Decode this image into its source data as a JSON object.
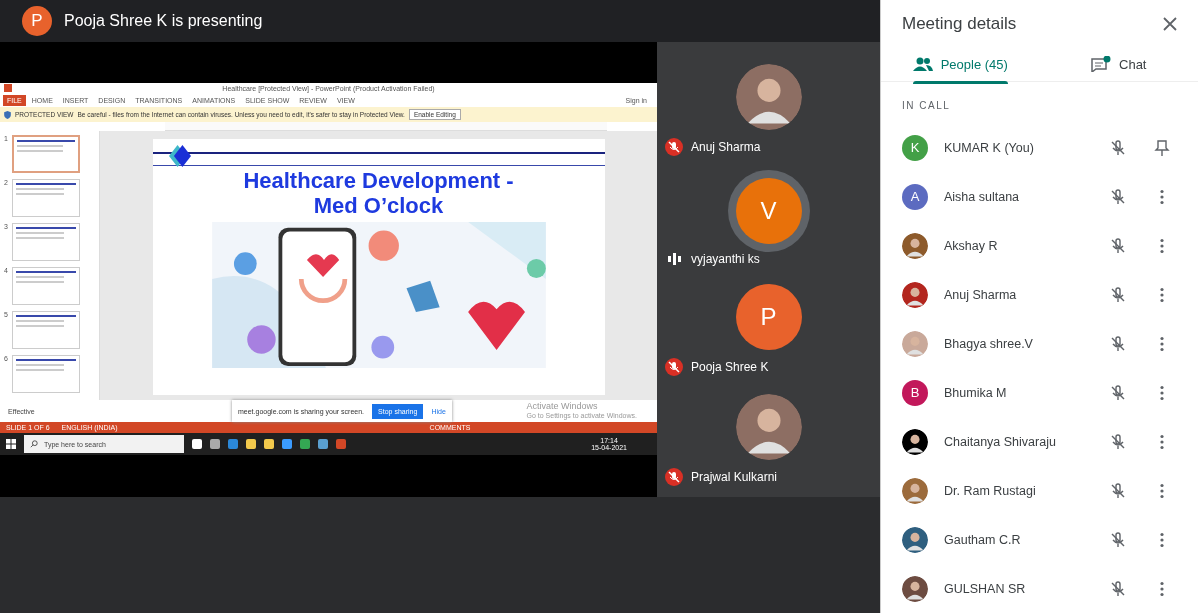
{
  "presenter_banner": {
    "letter": "P",
    "color": "#e8622c",
    "text": "Pooja Shree K is presenting"
  },
  "shared_screen": {
    "app_title": "Healthcare [Protected View] - PowerPoint (Product Activation Failed)",
    "ribbon_tabs": [
      {
        "label": "FILE",
        "selected": true
      },
      {
        "label": "HOME",
        "selected": false
      },
      {
        "label": "INSERT",
        "selected": false
      },
      {
        "label": "DESIGN",
        "selected": false
      },
      {
        "label": "TRANSITIONS",
        "selected": false
      },
      {
        "label": "ANIMATIONS",
        "selected": false
      },
      {
        "label": "SLIDE SHOW",
        "selected": false
      },
      {
        "label": "REVIEW",
        "selected": false
      },
      {
        "label": "VIEW",
        "selected": false
      }
    ],
    "sign_in": "Sign in",
    "protected_bar": {
      "label": "PROTECTED VIEW",
      "message": "Be careful - files from the Internet can contain viruses. Unless you need to edit, it's safer to stay in Protected View.",
      "button": "Enable Editing"
    },
    "thumbnails": [
      {
        "number": "1",
        "selected": true
      },
      {
        "number": "2",
        "selected": false
      },
      {
        "number": "3",
        "selected": false
      },
      {
        "number": "4",
        "selected": false
      },
      {
        "number": "5",
        "selected": false
      },
      {
        "number": "6",
        "selected": false
      }
    ],
    "slide": {
      "title": "Healthcare Development -",
      "subtitle": "Med O’clock"
    },
    "notes": "Effective",
    "activation": {
      "title": "Activate Windows",
      "text": "Go to Settings to activate Windows."
    },
    "sharing_bar": {
      "message": "meet.google.com is sharing your screen.",
      "stop": "Stop sharing",
      "hide": "Hide"
    },
    "status_bar": [
      "SLIDE 1 OF 6",
      "ENGLISH (INDIA)",
      "COMMENTS"
    ],
    "taskbar": {
      "search_placeholder": "Type here to search",
      "time": "17:14",
      "date": "15-04-2021"
    }
  },
  "tiles": [
    {
      "name": "Anuj Sharma",
      "muted": true
    },
    {
      "name": "vyjayanthi ks",
      "kind": "letter",
      "letter": "V",
      "color": "#e8710a",
      "muted": false
    },
    {
      "name": "Pooja Shree K",
      "kind": "letter",
      "letter": "P",
      "color": "#e8622c",
      "muted": true
    },
    {
      "name": "Prajwal Kulkarni",
      "muted": true
    }
  ],
  "panel": {
    "title": "Meeting details",
    "tabs": [
      {
        "label": "People (45)",
        "kind": "people",
        "selected": true
      },
      {
        "label": "Chat",
        "kind": "chat",
        "selected": false,
        "unread": true
      }
    ],
    "section": "IN CALL",
    "people": [
      {
        "name": "KUMAR K (You)",
        "kind": "letter",
        "letter": "K",
        "color": "#43a047",
        "self": true
      },
      {
        "name": "Aisha sultana",
        "kind": "letter",
        "letter": "A",
        "color": "#5c6bc0",
        "self": false
      },
      {
        "name": "Akshay R",
        "color": "#8d5a2b",
        "self": false
      },
      {
        "name": "Anuj Sharma",
        "color": "#b3261e",
        "self": false
      },
      {
        "name": "Bhagya shree.V",
        "color": "#c9a99a",
        "self": false
      },
      {
        "name": "Bhumika M",
        "kind": "letter",
        "letter": "B",
        "color": "#c2185b",
        "self": false
      },
      {
        "name": "Chaitanya Shivaraju",
        "color": "#000000",
        "self": false
      },
      {
        "name": "Dr. Ram Rustagi",
        "color": "#9c6b3c",
        "self": false
      },
      {
        "name": "Gautham C.R",
        "color": "#2f5f7f",
        "self": false
      },
      {
        "name": "GULSHAN SR",
        "color": "#6d4c41",
        "self": false
      }
    ]
  }
}
